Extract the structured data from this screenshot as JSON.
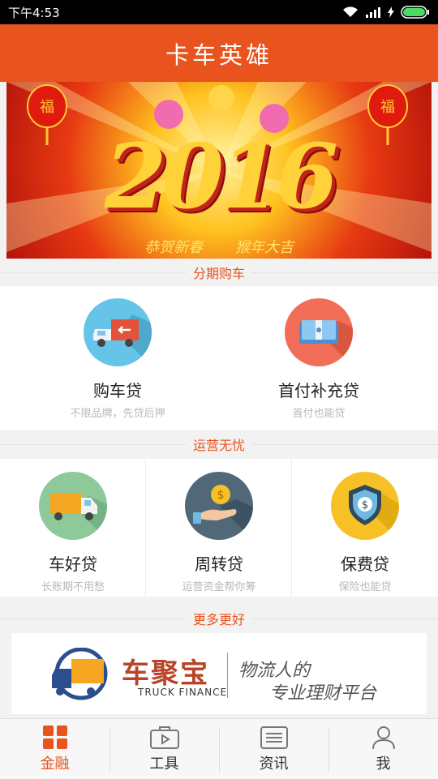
{
  "status_bar": {
    "time": "下午4:53"
  },
  "app": {
    "title": "卡车英雄"
  },
  "banner": {
    "year": "2016",
    "slogan_left": "恭贺新春",
    "slogan_right": "猴年大吉"
  },
  "sections": {
    "installment": {
      "title": "分期购车",
      "items": [
        {
          "title": "购车贷",
          "subtitle": "不限品牌，先贷后押",
          "icon": "truck-icon"
        },
        {
          "title": "首付补充贷",
          "subtitle": "首付也能贷",
          "icon": "cash-icon"
        }
      ]
    },
    "operations": {
      "title": "运营无忧",
      "items": [
        {
          "title": "车好贷",
          "subtitle": "长账期不用愁",
          "icon": "truck-icon"
        },
        {
          "title": "周转贷",
          "subtitle": "运营资金帮你筹",
          "icon": "coin-hand-icon"
        },
        {
          "title": "保费贷",
          "subtitle": "保险也能贷",
          "icon": "shield-dollar-icon"
        }
      ]
    },
    "more": {
      "title": "更多更好"
    }
  },
  "ad": {
    "brand_cn": "车聚宝",
    "brand_en": "TRUCK FINANCE",
    "slogan_line1": "物流人的",
    "slogan_line2": "专业理财平台"
  },
  "tabs": [
    {
      "label": "金融",
      "icon": "grid-icon",
      "active": true
    },
    {
      "label": "工具",
      "icon": "toolbox-icon",
      "active": false
    },
    {
      "label": "资讯",
      "icon": "news-icon",
      "active": false
    },
    {
      "label": "我",
      "icon": "person-icon",
      "active": false
    }
  ],
  "colors": {
    "accent": "#e8531e",
    "subtitle": "#b8b8b8"
  }
}
